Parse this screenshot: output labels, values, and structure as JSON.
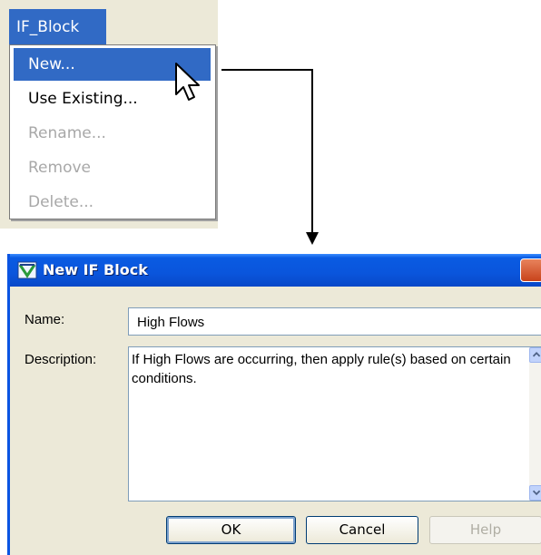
{
  "menu": {
    "title": "IF_Block",
    "items": [
      {
        "label": "New...",
        "state": "selected"
      },
      {
        "label": "Use Existing...",
        "state": "enabled"
      },
      {
        "label": "Rename...",
        "state": "disabled"
      },
      {
        "label": "Remove",
        "state": "disabled"
      },
      {
        "label": "Delete...",
        "state": "disabled"
      }
    ]
  },
  "dialog": {
    "title": "New IF Block",
    "name_label": "Name:",
    "name_value": "High Flows",
    "description_label": "Description:",
    "description_value": "If High Flows are occurring, then apply rule(s) based on certain conditions.",
    "buttons": {
      "ok": "OK",
      "cancel": "Cancel",
      "help": "Help"
    }
  },
  "colors": {
    "selection": "#316ac5",
    "titlebar": "#0a55dc",
    "dialog_bg": "#ece9d8"
  }
}
